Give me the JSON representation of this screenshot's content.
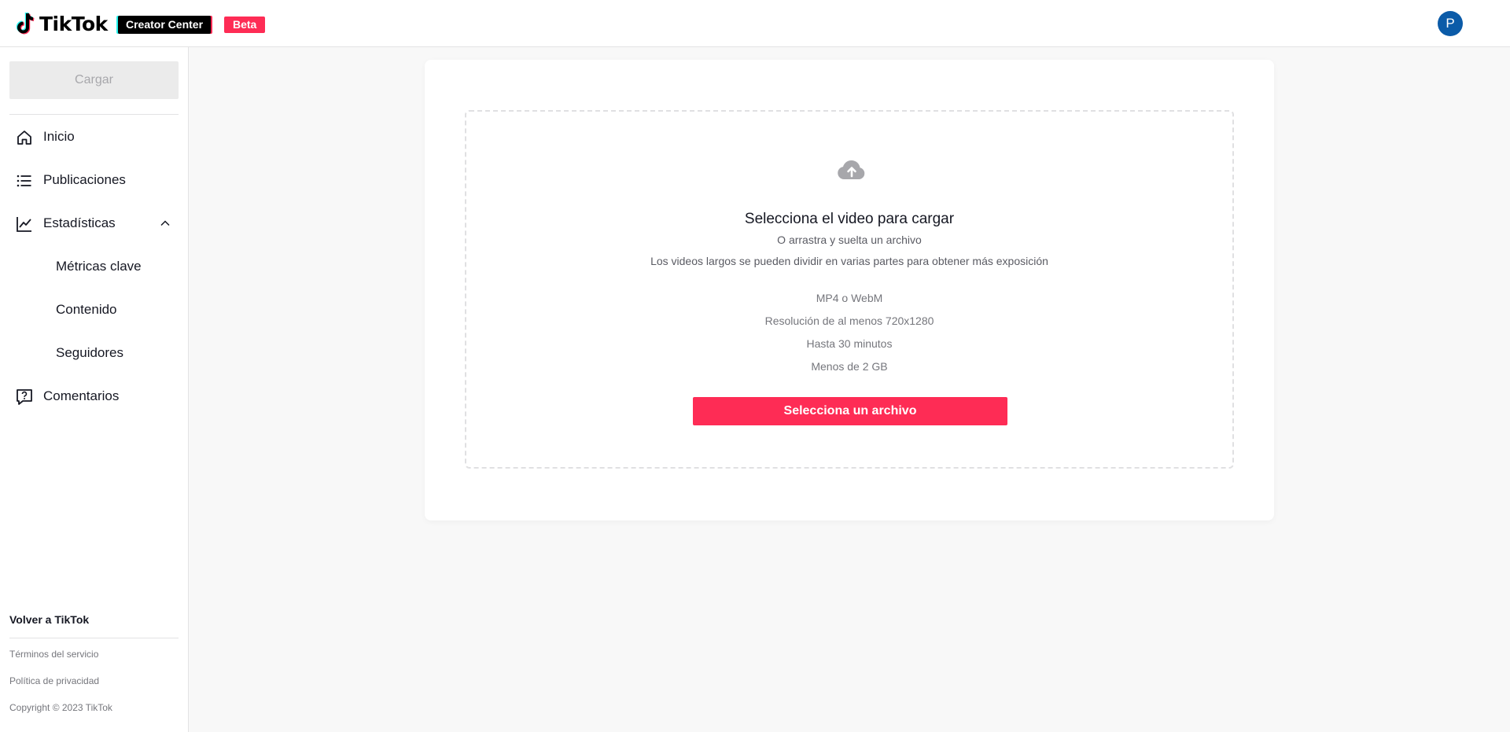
{
  "header": {
    "brand": "TikTok",
    "creator_center": "Creator Center",
    "beta": "Beta",
    "avatar_initial": "P",
    "avatar_color": "#0b5ba8"
  },
  "sidebar": {
    "upload_label": "Cargar",
    "items": [
      {
        "label": "Inicio",
        "icon": "home-icon"
      },
      {
        "label": "Publicaciones",
        "icon": "list-icon"
      },
      {
        "label": "Estadísticas",
        "icon": "chart-icon",
        "expanded": true
      },
      {
        "label": "Métricas clave"
      },
      {
        "label": "Contenido"
      },
      {
        "label": "Seguidores"
      },
      {
        "label": "Comentarios",
        "icon": "comment-question-icon"
      }
    ],
    "back_link": "Volver a TikTok",
    "footer": {
      "terms": "Términos del servicio",
      "privacy": "Política de privacidad",
      "copyright": "Copyright © 2023 TikTok"
    }
  },
  "upload": {
    "title": "Selecciona el video para cargar",
    "subtitle": "O arrastra y suelta un archivo",
    "hint": "Los videos largos se pueden dividir en varias partes para obtener más exposición",
    "specs": [
      "MP4 o WebM",
      "Resolución de al menos 720x1280",
      "Hasta 30 minutos",
      "Menos de 2 GB"
    ],
    "button_label": "Selecciona un archivo"
  },
  "colors": {
    "accent": "#fe2c55",
    "cyan": "#25f4ee"
  }
}
